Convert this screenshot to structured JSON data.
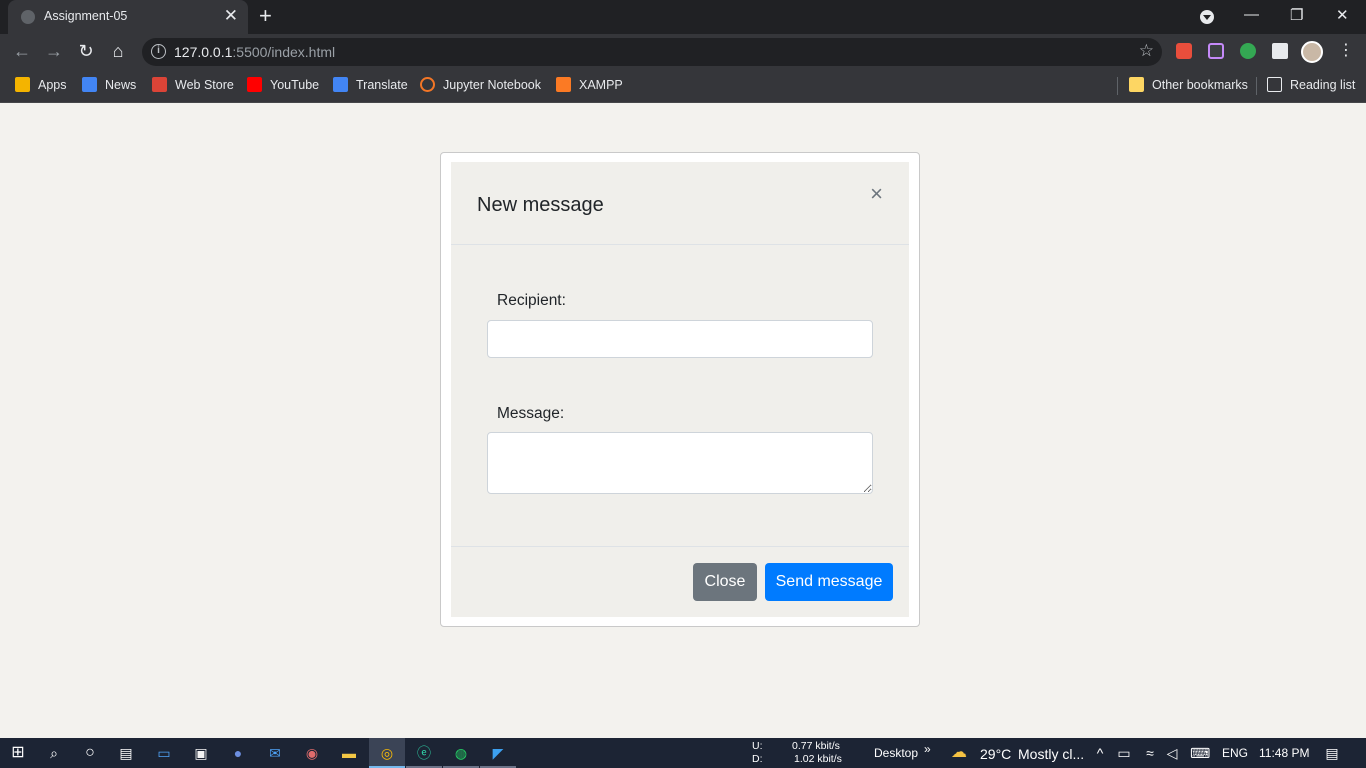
{
  "browser": {
    "tab_title": "Assignment-05",
    "tab_close": "✕",
    "new_tab": "+",
    "url_host": "127.0.0.1",
    "url_rest": ":5500/index.html",
    "info_glyph": "i",
    "window_controls": {
      "minimize": "—",
      "restore": "❐",
      "close": "✕"
    }
  },
  "bookmarks": {
    "items": [
      {
        "label": "Apps",
        "icon": "apps-grid-icon",
        "color": "#f4b400"
      },
      {
        "label": "News",
        "icon": "google-news-icon",
        "color": "#4285f4"
      },
      {
        "label": "Web Store",
        "icon": "web-store-icon",
        "color": "#db4437"
      },
      {
        "label": "YouTube",
        "icon": "youtube-icon",
        "color": "#ff0000"
      },
      {
        "label": "Translate",
        "icon": "google-translate-icon",
        "color": "#4285f4"
      },
      {
        "label": "Jupyter Notebook",
        "icon": "jupyter-icon",
        "color": "#f37626"
      },
      {
        "label": "XAMPP",
        "icon": "xampp-icon",
        "color": "#fb7a24"
      }
    ],
    "other": "Other bookmarks",
    "reading_list": "Reading list"
  },
  "modal": {
    "title": "New message",
    "close_glyph": "×",
    "recipient_label": "Recipient:",
    "recipient_value": "",
    "message_label": "Message:",
    "message_value": "",
    "close_button": "Close",
    "send_button": "Send message",
    "colors": {
      "primary": "#007bff",
      "secondary": "#6c757d"
    }
  },
  "taskbar": {
    "net_up_label": "U:",
    "net_up": "0.77 kbit/s",
    "net_down_label": "D:",
    "net_down": "1.02 kbit/s",
    "desktop": "Desktop",
    "desktop_chevron": "»",
    "weather_temp": "29°C",
    "weather_desc": "Mostly cl...",
    "language": "ENG",
    "time": "11:48 PM"
  }
}
